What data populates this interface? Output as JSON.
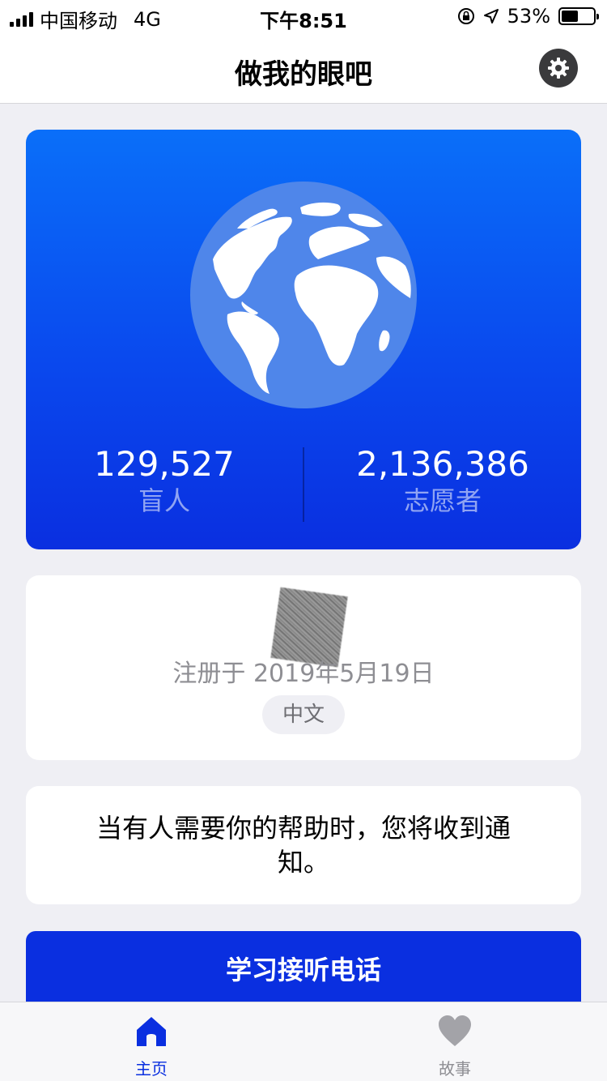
{
  "status_bar": {
    "carrier": "中国移动",
    "network": "4G",
    "time": "下午8:51",
    "battery_percent": "53%",
    "battery_level": 0.53
  },
  "nav": {
    "title": "做我的眼吧",
    "settings_icon": "gear-icon"
  },
  "hero": {
    "globe_icon": "globe-icon",
    "stats": [
      {
        "value": "129,527",
        "label": "盲人"
      },
      {
        "value": "2,136,386",
        "label": "志愿者"
      }
    ],
    "gradient_colors": [
      "#0a6ff9",
      "#0a2fe0"
    ]
  },
  "profile": {
    "registered_text": "注册于 2019年5月19日",
    "language": "中文"
  },
  "notice": {
    "text": "当有人需要你的帮助时，您将收到通知。"
  },
  "learn_button": {
    "label": "学习接听电话"
  },
  "tab_bar": {
    "tabs": [
      {
        "label": "主页",
        "icon": "home-icon",
        "active": true
      },
      {
        "label": "故事",
        "icon": "heart-icon",
        "active": false
      }
    ],
    "active_color": "#0a2fe0",
    "inactive_color": "#8e8e93"
  }
}
